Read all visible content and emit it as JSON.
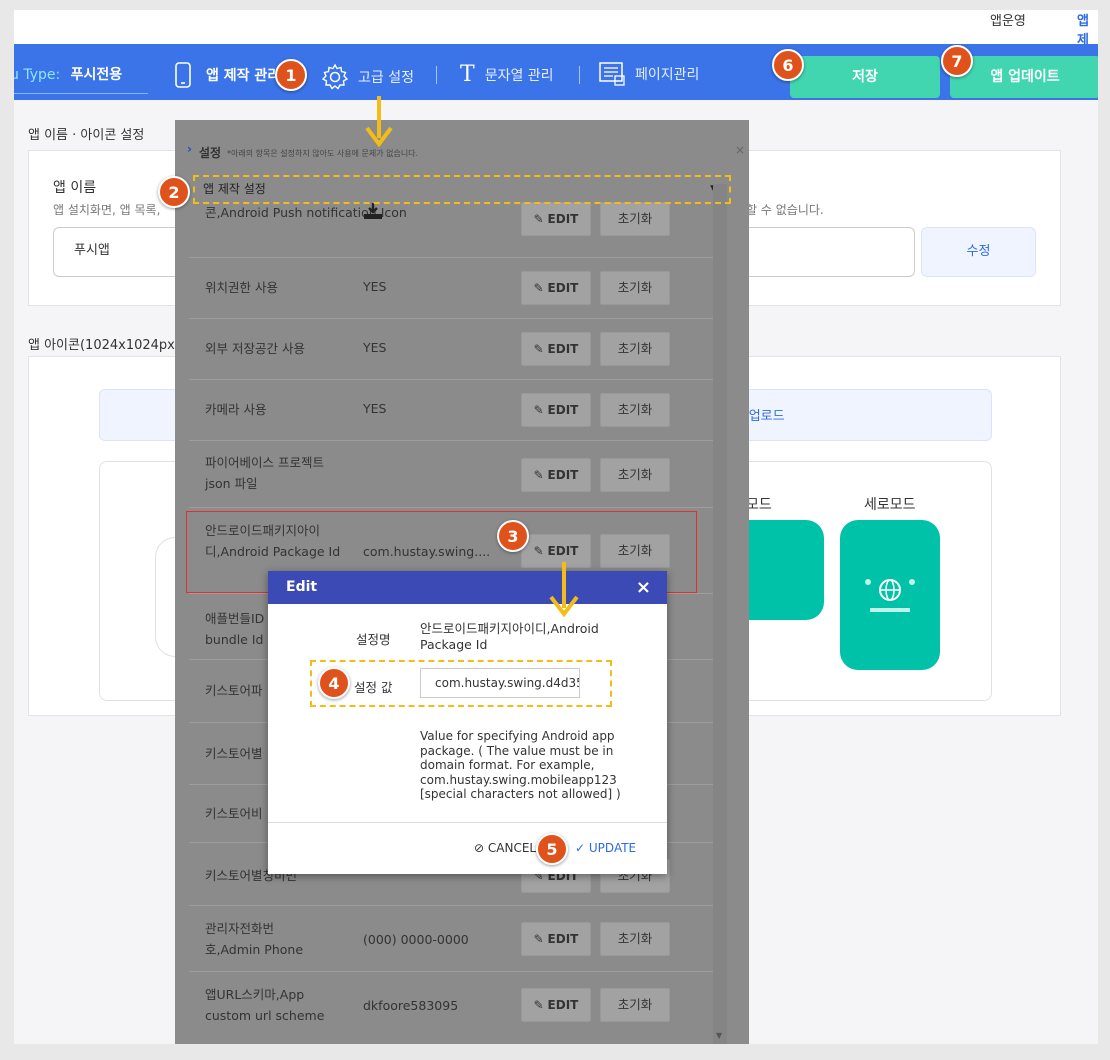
{
  "topbar": {
    "link1": "앱운영",
    "link2": "앱제"
  },
  "nav": {
    "menu_type_label": "u Type:",
    "menu_type_value": "푸시전용",
    "items": [
      {
        "label": "앱 제작 관리"
      },
      {
        "label": "고급 설정"
      },
      {
        "label": "문자열 관리"
      },
      {
        "label": "페이지관리"
      }
    ],
    "save": "저장",
    "update_app": "앱 업데이트"
  },
  "content": {
    "section1": "앱 이름 · 아이콘 설정",
    "app_name_label": "앱 이름",
    "app_name_desc": "앱 설치화면, 앱 목록,",
    "app_name_desc_right": "경할 수 없습니다.",
    "app_name_value": "푸시앱",
    "modify": "수정",
    "section2": "앱 아이콘(1024x1024px",
    "splash_upload": "대기화면 업로드",
    "landscape": "모드",
    "portrait": "세로모드"
  },
  "panel": {
    "title": "설정",
    "note": "*아래의 항목은 설정하지 않아도 사용에 문제가 없습니다.",
    "select": "앱 제작 설정",
    "edit": "EDIT",
    "reset": "초기화",
    "rows": [
      {
        "name": "콘,Android Push notification Icon",
        "value": ""
      },
      {
        "name": "위치권한 사용",
        "value": "YES"
      },
      {
        "name": "외부 저장공간 사용",
        "value": "YES"
      },
      {
        "name": "카메라 사용",
        "value": "YES"
      },
      {
        "name": "파이어베이스 프로젝트 json 파일",
        "value": ""
      },
      {
        "name": "안드로이드패키지아이디,Android Package Id",
        "value": "com.hustay.swing...."
      },
      {
        "name": "애플번들ID bundle Id",
        "value": ""
      },
      {
        "name": "키스토어파",
        "value": ""
      },
      {
        "name": "키스토어별",
        "value": ""
      },
      {
        "name": "키스토어비",
        "value": ""
      },
      {
        "name": "키스토어별칭비번",
        "value": ""
      },
      {
        "name": "관리자전화번호,Admin Phone",
        "value": "(000) 0000-0000"
      },
      {
        "name": "앱URL스키마,App custom url scheme",
        "value": "dkfoore583095"
      }
    ]
  },
  "dialog": {
    "title": "Edit",
    "name_label": "설정명",
    "name_value": "안드로이드패키지아이디,Android Package Id",
    "value_label": "설정 값",
    "value": "com.hustay.swing.d4d35",
    "help": "Value for specifying Android app package. ( The value must be in domain format. For example, com.hustay.swing.mobileapp123 [special characters not allowed] )",
    "cancel": "CANCEL",
    "update": "UPDATE"
  },
  "badges": [
    "1",
    "2",
    "3",
    "4",
    "5",
    "6",
    "7"
  ],
  "colors": {
    "nav": "#3a74e8",
    "mint": "#41d6b0",
    "dialog_head": "#3c4ab5",
    "badge": "#e0521b",
    "highlight": "#f3bc16"
  }
}
